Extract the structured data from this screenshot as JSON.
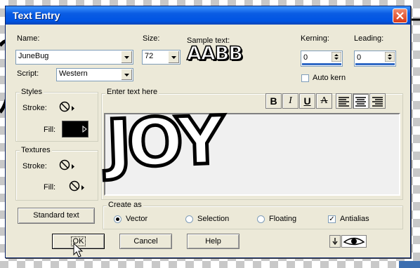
{
  "window": {
    "title": "Text Entry"
  },
  "font": {
    "label": "Name:",
    "value": "JuneBug"
  },
  "size": {
    "label": "Size:",
    "value": "72"
  },
  "sample": {
    "label": "Sample text:",
    "preview": "AABB"
  },
  "kerning": {
    "label": "Kerning:",
    "value": "0"
  },
  "leading": {
    "label": "Leading:",
    "value": "0"
  },
  "autokern": {
    "label": "Auto kern",
    "checked": false
  },
  "script": {
    "label": "Script:",
    "value": "Western"
  },
  "styles": {
    "title": "Styles",
    "stroke_label": "Stroke:",
    "fill_label": "Fill:",
    "fill_color": "#000000"
  },
  "textures": {
    "title": "Textures",
    "stroke_label": "Stroke:",
    "fill_label": "Fill:"
  },
  "entry": {
    "label": "Enter text here",
    "text": "JOY"
  },
  "format_buttons": [
    "B",
    "I",
    "U",
    "A"
  ],
  "create_as": {
    "title": "Create as",
    "options": [
      "Vector",
      "Selection",
      "Floating"
    ],
    "selected": "Vector",
    "antialias_label": "Antialias",
    "antialias_checked": true
  },
  "buttons": {
    "standard_text": "Standard text",
    "ok": "OK",
    "cancel": "Cancel",
    "help": "Help"
  },
  "colors": {
    "title_bar": "#0054e3",
    "dialog_bg": "#ece9d8",
    "accent": "#316ac5"
  }
}
